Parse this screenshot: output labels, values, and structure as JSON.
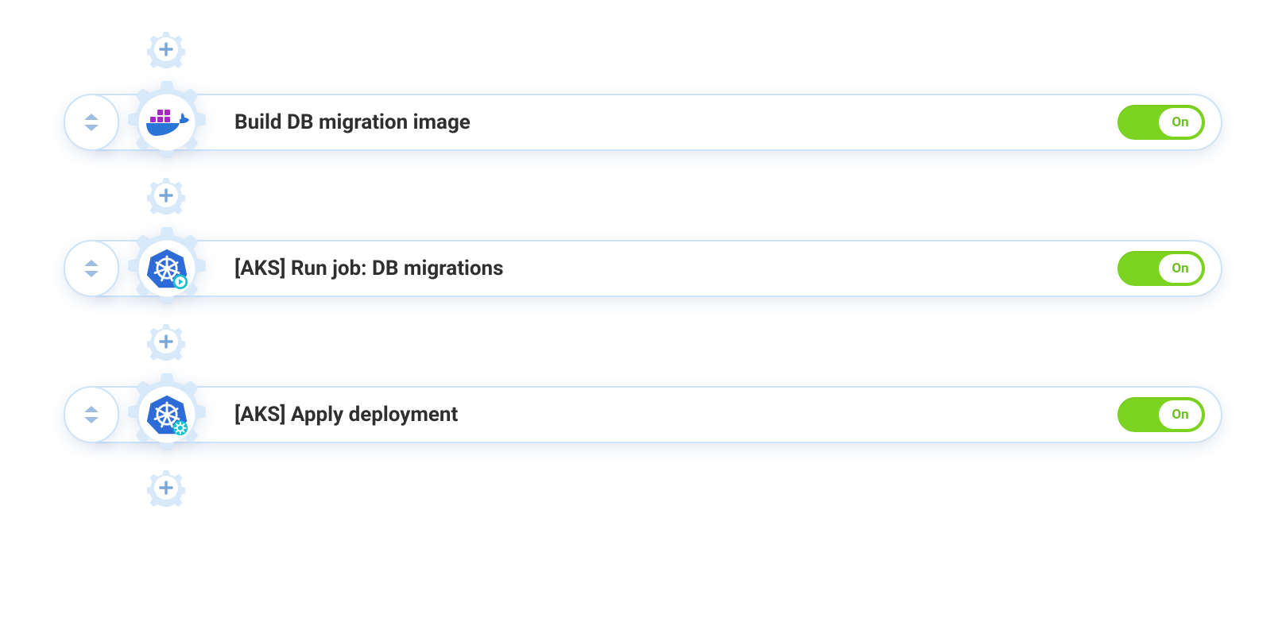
{
  "toggle": {
    "on_label": "On"
  },
  "colors": {
    "gear_tint": "#cfe3f7",
    "plus": "#7ba9d6",
    "toggle_on": "#7cd420",
    "toggle_text": "#6cbf1c"
  },
  "steps": [
    {
      "title": "Build DB migration image",
      "icon": "docker-icon",
      "enabled": true
    },
    {
      "title": "[AKS] Run job: DB migrations",
      "icon": "kubernetes-play-icon",
      "enabled": true
    },
    {
      "title": "[AKS] Apply deployment",
      "icon": "kubernetes-gear-icon",
      "enabled": true
    }
  ]
}
